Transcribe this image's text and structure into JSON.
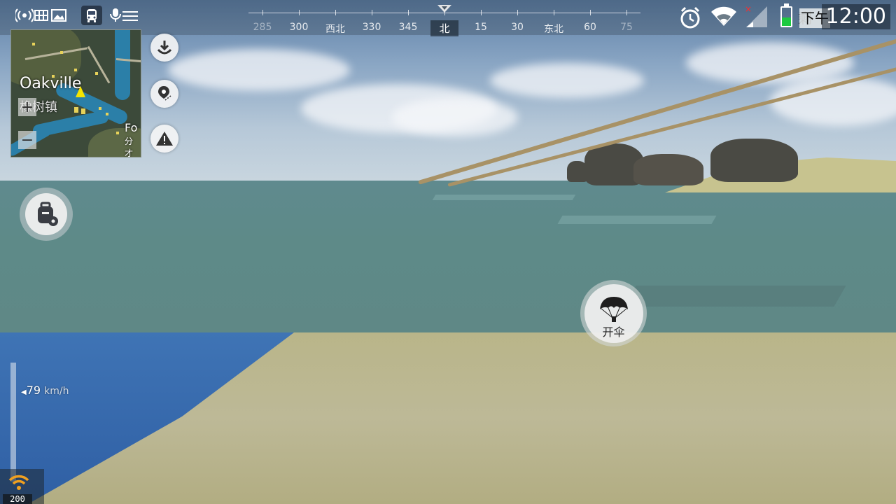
{
  "compass": {
    "headings": [
      {
        "label": "285",
        "style": "dim"
      },
      {
        "label": "300",
        "style": "normal"
      },
      {
        "label": "西北",
        "style": "normal"
      },
      {
        "label": "330",
        "style": "normal"
      },
      {
        "label": "345",
        "style": "normal"
      },
      {
        "label": "北",
        "style": "current"
      },
      {
        "label": "15",
        "style": "normal"
      },
      {
        "label": "30",
        "style": "normal"
      },
      {
        "label": "东北",
        "style": "normal"
      },
      {
        "label": "60",
        "style": "normal"
      },
      {
        "label": "75",
        "style": "dim"
      }
    ]
  },
  "status_bar": {
    "time_prefix": "下午",
    "time_prefix_overlay": "剩",
    "clock": "12:00",
    "battery_level": 0.45,
    "battery_color": "#1dc941"
  },
  "minimap": {
    "place_en": "Oakville",
    "place_zh": "橡树镇",
    "place2_en": "Fo",
    "place2_zh": "分才",
    "zoom_in_label": "+",
    "zoom_out_label": "−"
  },
  "side_buttons": {
    "icons": [
      "download-icon",
      "location-pin-icon",
      "warning-icon"
    ]
  },
  "parachute": {
    "label": "开伞"
  },
  "speed": {
    "value": "79",
    "unit": "km/h"
  },
  "ping": {
    "value": "200"
  },
  "colors": {
    "accent_yellow": "#f4e400",
    "wifi_orange": "#f0a020"
  }
}
